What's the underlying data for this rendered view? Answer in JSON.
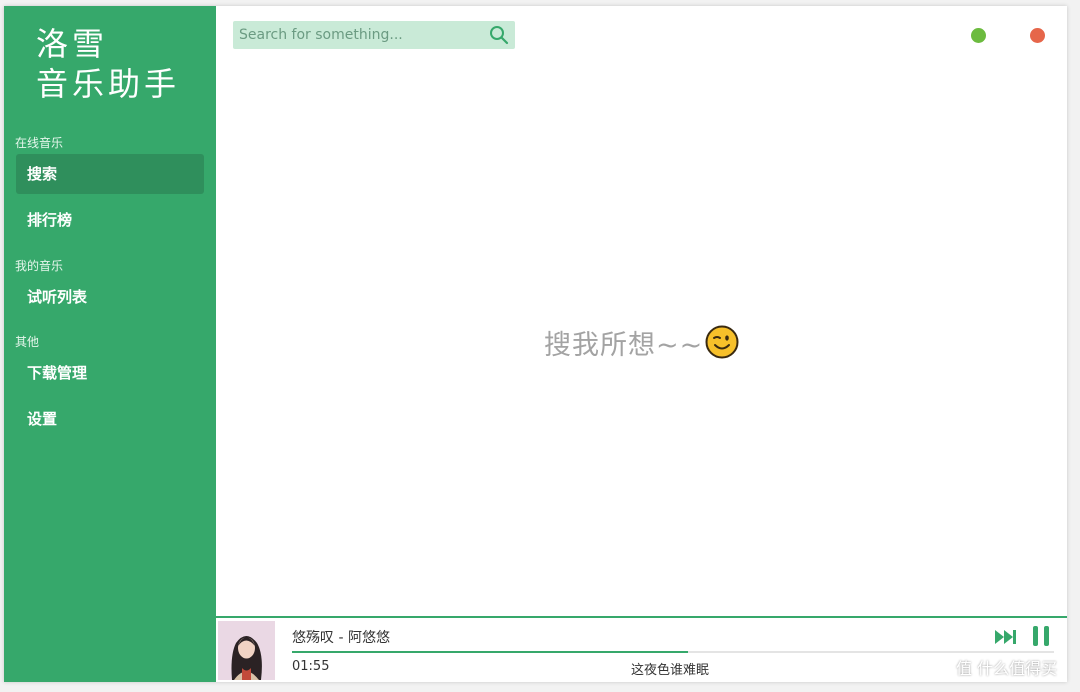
{
  "app": {
    "logo_line1": "洛雪",
    "logo_line2": "音乐助手"
  },
  "sidebar": {
    "sections": [
      {
        "label": "在线音乐"
      },
      {
        "label": "我的音乐"
      },
      {
        "label": "其他"
      }
    ],
    "items": [
      {
        "label": "搜索",
        "active": true
      },
      {
        "label": "排行榜"
      },
      {
        "label": "试听列表"
      },
      {
        "label": "下载管理"
      },
      {
        "label": "设置"
      }
    ]
  },
  "search": {
    "placeholder": "Search for something...",
    "value": ""
  },
  "main": {
    "empty_text": "搜我所想~~"
  },
  "player": {
    "song_title": "悠殇叹 - 阿悠悠",
    "current_time": "01:55",
    "lyric": "这夜色谁难眠",
    "progress": 0.52
  },
  "watermark": {
    "text": "值 什么值得买"
  },
  "colors": {
    "accent": "#36a86b",
    "accent_dark": "#2f8f5c",
    "search_bg": "#c9ead7",
    "min_dot": "#6cbb3f",
    "close_dot": "#e6664a"
  },
  "icons": {
    "search": "search-icon",
    "emoji": "wink-emoji-icon",
    "next": "next-track-icon",
    "pause": "pause-icon"
  }
}
